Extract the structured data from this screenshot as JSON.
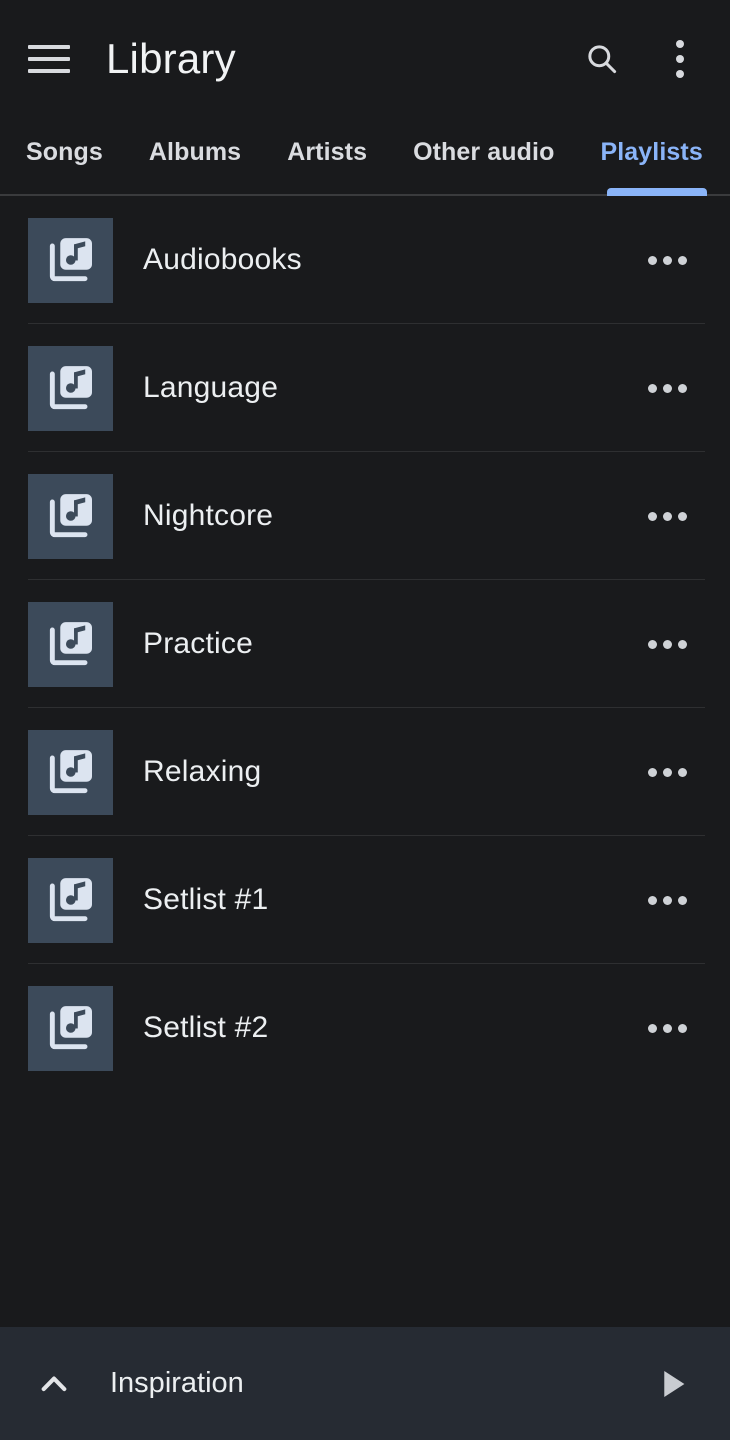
{
  "appbar": {
    "menu_icon": "hamburger-menu-icon",
    "title": "Library",
    "search_icon": "search-icon",
    "overflow_icon": "more-vert-icon"
  },
  "tabs": {
    "items": [
      {
        "label": "Songs",
        "active": false
      },
      {
        "label": "Albums",
        "active": false
      },
      {
        "label": "Artists",
        "active": false
      },
      {
        "label": "Other audio",
        "active": false
      },
      {
        "label": "Playlists",
        "active": true
      }
    ],
    "active_index": 4,
    "active_color": "#8ab4f8"
  },
  "playlists": {
    "item_icon": "library-music-icon",
    "overflow_icon": "more-horiz-icon",
    "items": [
      {
        "name": "Audiobooks"
      },
      {
        "name": "Language"
      },
      {
        "name": "Nightcore"
      },
      {
        "name": "Practice"
      },
      {
        "name": "Relaxing"
      },
      {
        "name": "Setlist #1"
      },
      {
        "name": "Setlist #2"
      }
    ]
  },
  "player": {
    "expand_icon": "chevron-up-icon",
    "title": "Inspiration",
    "play_icon": "play-icon",
    "background_color": "#262b33"
  },
  "theme": {
    "background": "#191a1c",
    "text_primary": "#eceff1",
    "accent": "#8ab4f8",
    "thumbnail_bg": "#3c4a5a",
    "divider": "#2e2f31"
  }
}
